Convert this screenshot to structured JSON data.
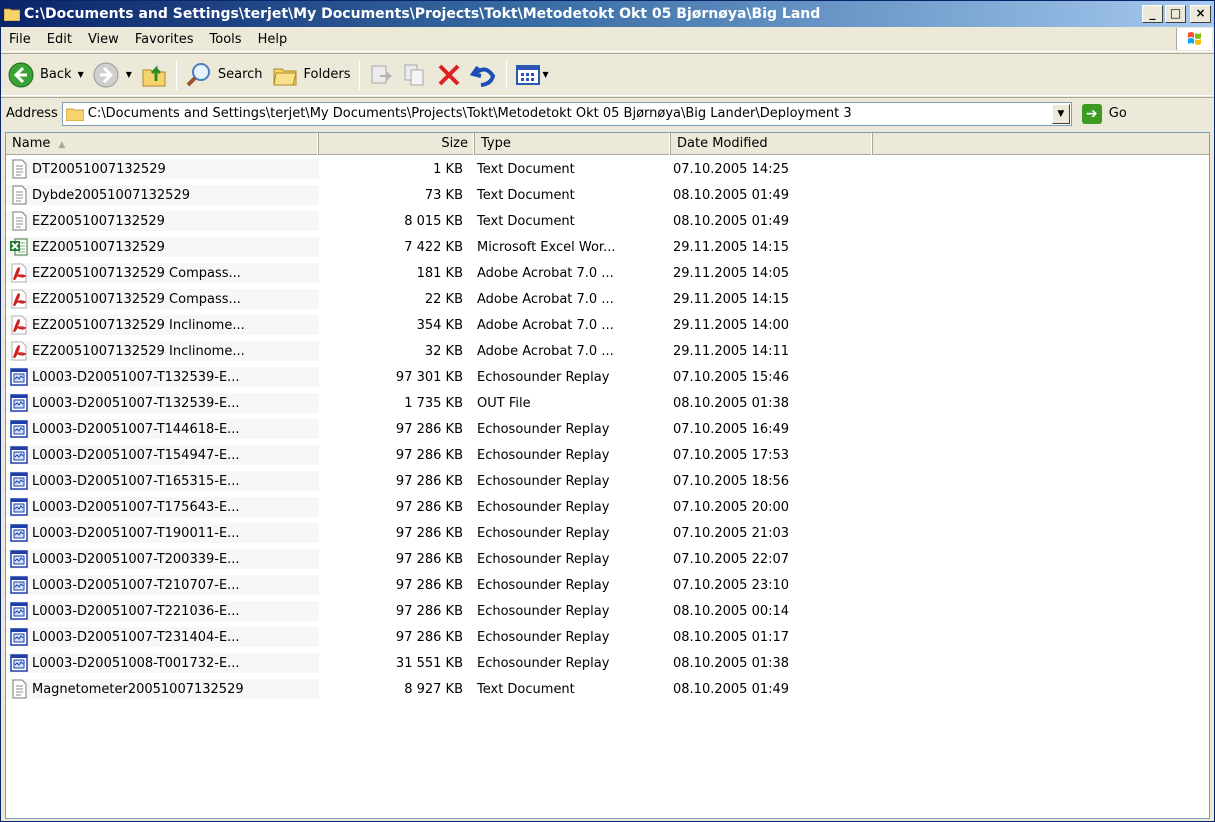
{
  "window": {
    "title": "C:\\Documents and Settings\\terjet\\My Documents\\Projects\\Tokt\\Metodetokt Okt 05 Bjørnøya\\Big Land",
    "min_label": "_",
    "max_label": "□",
    "close_label": "×"
  },
  "menu": {
    "file": "File",
    "edit": "Edit",
    "view": "View",
    "favorites": "Favorites",
    "tools": "Tools",
    "help": "Help"
  },
  "toolbar": {
    "back": "Back",
    "search": "Search",
    "folders": "Folders"
  },
  "address": {
    "label": "Address",
    "value": "C:\\Documents and Settings\\terjet\\My Documents\\Projects\\Tokt\\Metodetokt Okt 05 Bjørnøya\\Big Lander\\Deployment 3",
    "go": "Go"
  },
  "columns": {
    "name": "Name",
    "size": "Size",
    "type": "Type",
    "date": "Date Modified"
  },
  "colors": {
    "title_start": "#0a246a",
    "title_end": "#a6caf0",
    "pdf_red": "#cc1f1f",
    "excel_green": "#1f7a2e",
    "echo_blue": "#1f3fa8"
  },
  "files": [
    {
      "name": "DT20051007132529",
      "size": "1 KB",
      "type": "Text Document",
      "date": "07.10.2005 14:25",
      "icon": "text-document-icon"
    },
    {
      "name": "Dybde20051007132529",
      "size": "73 KB",
      "type": "Text Document",
      "date": "08.10.2005 01:49",
      "icon": "text-document-icon"
    },
    {
      "name": "EZ20051007132529",
      "size": "8 015 KB",
      "type": "Text Document",
      "date": "08.10.2005 01:49",
      "icon": "text-document-icon"
    },
    {
      "name": "EZ20051007132529",
      "size": "7 422 KB",
      "type": "Microsoft Excel Wor...",
      "date": "29.11.2005 14:15",
      "icon": "excel-icon"
    },
    {
      "name": "EZ20051007132529 Compass...",
      "size": "181 KB",
      "type": "Adobe Acrobat 7.0 ...",
      "date": "29.11.2005 14:05",
      "icon": "pdf-icon"
    },
    {
      "name": "EZ20051007132529 Compass...",
      "size": "22 KB",
      "type": "Adobe Acrobat 7.0 ...",
      "date": "29.11.2005 14:15",
      "icon": "pdf-icon"
    },
    {
      "name": "EZ20051007132529 Inclinome...",
      "size": "354 KB",
      "type": "Adobe Acrobat 7.0 ...",
      "date": "29.11.2005 14:00",
      "icon": "pdf-icon"
    },
    {
      "name": "EZ20051007132529 Inclinome...",
      "size": "32 KB",
      "type": "Adobe Acrobat 7.0 ...",
      "date": "29.11.2005 14:11",
      "icon": "pdf-icon"
    },
    {
      "name": "L0003-D20051007-T132539-E...",
      "size": "97 301 KB",
      "type": "Echosounder Replay",
      "date": "07.10.2005 15:46",
      "icon": "echosounder-icon"
    },
    {
      "name": "L0003-D20051007-T132539-E...",
      "size": "1 735 KB",
      "type": "OUT File",
      "date": "08.10.2005 01:38",
      "icon": "echosounder-icon"
    },
    {
      "name": "L0003-D20051007-T144618-E...",
      "size": "97 286 KB",
      "type": "Echosounder Replay",
      "date": "07.10.2005 16:49",
      "icon": "echosounder-icon"
    },
    {
      "name": "L0003-D20051007-T154947-E...",
      "size": "97 286 KB",
      "type": "Echosounder Replay",
      "date": "07.10.2005 17:53",
      "icon": "echosounder-icon"
    },
    {
      "name": "L0003-D20051007-T165315-E...",
      "size": "97 286 KB",
      "type": "Echosounder Replay",
      "date": "07.10.2005 18:56",
      "icon": "echosounder-icon"
    },
    {
      "name": "L0003-D20051007-T175643-E...",
      "size": "97 286 KB",
      "type": "Echosounder Replay",
      "date": "07.10.2005 20:00",
      "icon": "echosounder-icon"
    },
    {
      "name": "L0003-D20051007-T190011-E...",
      "size": "97 286 KB",
      "type": "Echosounder Replay",
      "date": "07.10.2005 21:03",
      "icon": "echosounder-icon"
    },
    {
      "name": "L0003-D20051007-T200339-E...",
      "size": "97 286 KB",
      "type": "Echosounder Replay",
      "date": "07.10.2005 22:07",
      "icon": "echosounder-icon"
    },
    {
      "name": "L0003-D20051007-T210707-E...",
      "size": "97 286 KB",
      "type": "Echosounder Replay",
      "date": "07.10.2005 23:10",
      "icon": "echosounder-icon"
    },
    {
      "name": "L0003-D20051007-T221036-E...",
      "size": "97 286 KB",
      "type": "Echosounder Replay",
      "date": "08.10.2005 00:14",
      "icon": "echosounder-icon"
    },
    {
      "name": "L0003-D20051007-T231404-E...",
      "size": "97 286 KB",
      "type": "Echosounder Replay",
      "date": "08.10.2005 01:17",
      "icon": "echosounder-icon"
    },
    {
      "name": "L0003-D20051008-T001732-E...",
      "size": "31 551 KB",
      "type": "Echosounder Replay",
      "date": "08.10.2005 01:38",
      "icon": "echosounder-icon"
    },
    {
      "name": "Magnetometer20051007132529",
      "size": "8 927 KB",
      "type": "Text Document",
      "date": "08.10.2005 01:49",
      "icon": "text-document-icon"
    }
  ]
}
